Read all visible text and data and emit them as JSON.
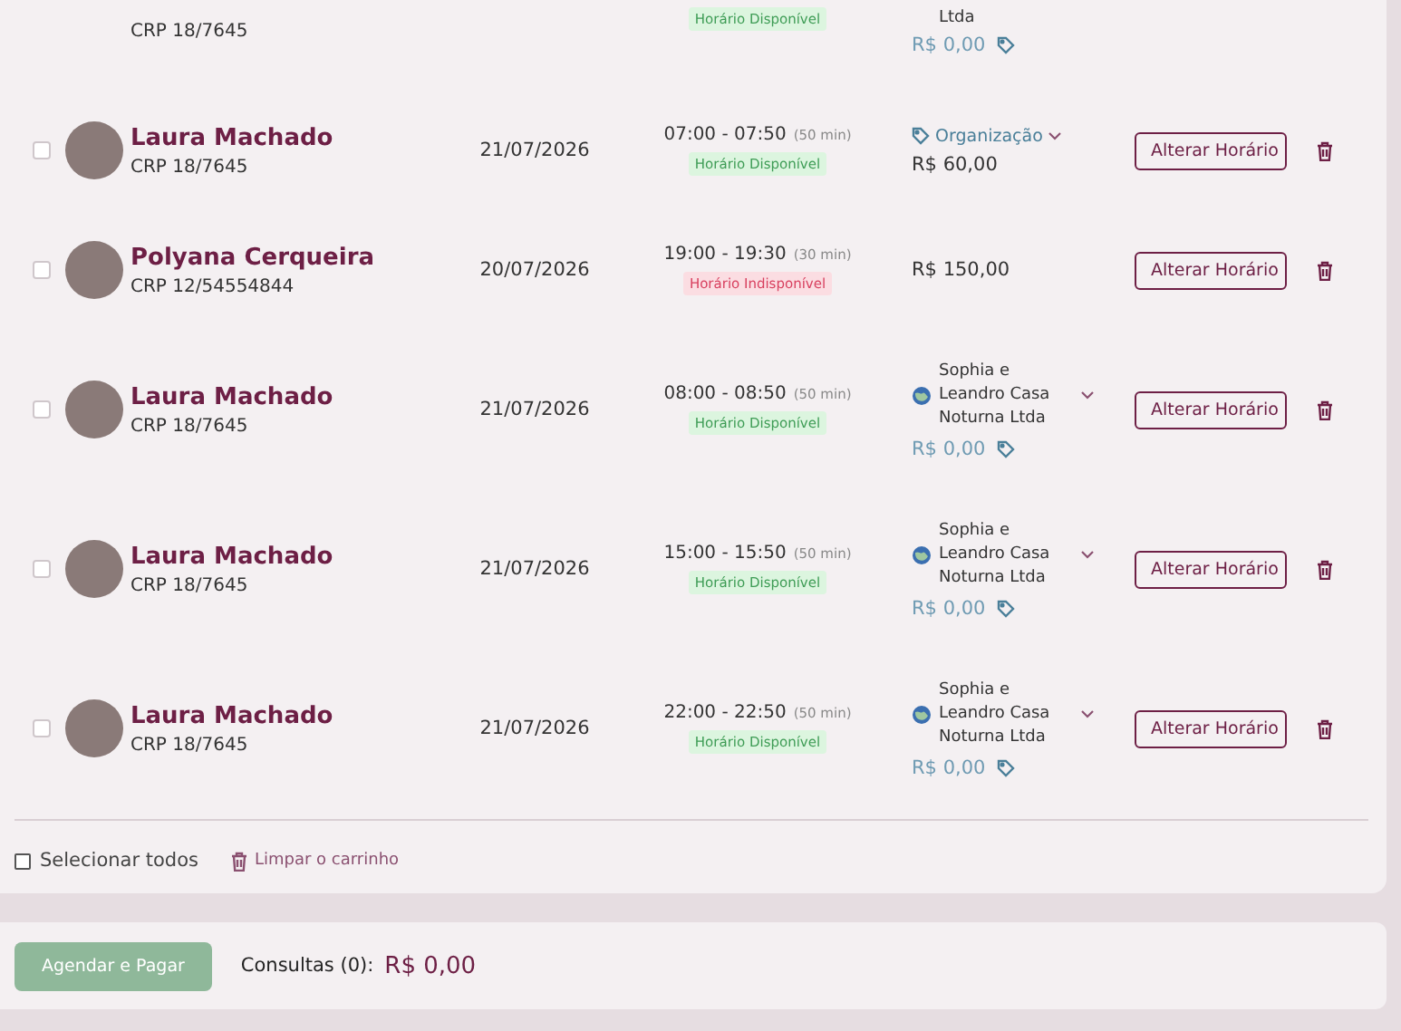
{
  "cart": {
    "partial_row": {
      "credential": "CRP 18/7645",
      "status": {
        "label": "Horário Disponível",
        "available": true
      },
      "company": "Ltda",
      "price": "R$ 0,00"
    },
    "rows": [
      {
        "kind": "tag",
        "checked": false,
        "name": "Laura Machado",
        "credential": "CRP 18/7645",
        "date": "21/07/2026",
        "time": "07:00 - 07:50",
        "duration": "(50 min)",
        "status": {
          "label": "Horário Disponível",
          "available": true
        },
        "billing": "Organização",
        "price": "R$ 60,00",
        "action": "Alterar Horário"
      },
      {
        "kind": "plain",
        "checked": false,
        "name": "Polyana Cerqueira",
        "credential": "CRP 12/54554844",
        "date": "20/07/2026",
        "time": "19:00 - 19:30",
        "duration": "(30 min)",
        "status": {
          "label": "Horário Indisponível",
          "available": false
        },
        "price": "R$ 150,00",
        "action": "Alterar Horário"
      },
      {
        "kind": "company",
        "checked": false,
        "name": "Laura Machado",
        "credential": "CRP 18/7645",
        "date": "21/07/2026",
        "time": "08:00 - 08:50",
        "duration": "(50 min)",
        "status": {
          "label": "Horário Disponível",
          "available": true
        },
        "billing": "Sophia e Leandro Casa Noturna Ltda",
        "price": "R$ 0,00",
        "action": "Alterar Horário"
      },
      {
        "kind": "company",
        "checked": false,
        "name": "Laura Machado",
        "credential": "CRP 18/7645",
        "date": "21/07/2026",
        "time": "15:00 - 15:50",
        "duration": "(50 min)",
        "status": {
          "label": "Horário Disponível",
          "available": true
        },
        "billing": "Sophia e Leandro Casa Noturna Ltda",
        "price": "R$ 0,00",
        "action": "Alterar Horário"
      },
      {
        "kind": "company",
        "checked": false,
        "name": "Laura Machado",
        "credential": "CRP 18/7645",
        "date": "21/07/2026",
        "time": "22:00 - 22:50",
        "duration": "(50 min)",
        "status": {
          "label": "Horário Disponível",
          "available": true
        },
        "billing": "Sophia e Leandro Casa Noturna Ltda",
        "price": "R$ 0,00",
        "action": "Alterar Horário"
      }
    ],
    "select_all": {
      "label": "Selecionar todos",
      "checked": false
    },
    "clear_cart": "Limpar o carrinho"
  },
  "checkout": {
    "button": {
      "label": "Agendar e Pagar",
      "disabled": true
    },
    "count_label": "Consultas (0):",
    "total": "R$ 0,00"
  }
}
